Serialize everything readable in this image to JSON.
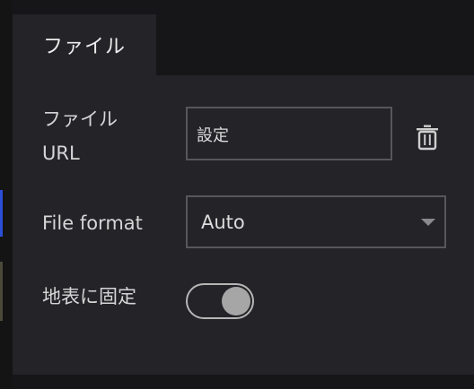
{
  "tabs": [
    {
      "label": "ファイル",
      "active": true
    }
  ],
  "form": {
    "url_label": "ファイル URL",
    "url_value": "設定",
    "format_label": "File format",
    "format_selected": "Auto",
    "clamp_label": "地表に固定",
    "clamp_on": true
  },
  "icons": {
    "delete": "trash-icon",
    "dropdown": "caret-down-icon"
  },
  "colors": {
    "panel_bg": "#232328",
    "border": "#56565c",
    "text": "#d6d6d6"
  }
}
